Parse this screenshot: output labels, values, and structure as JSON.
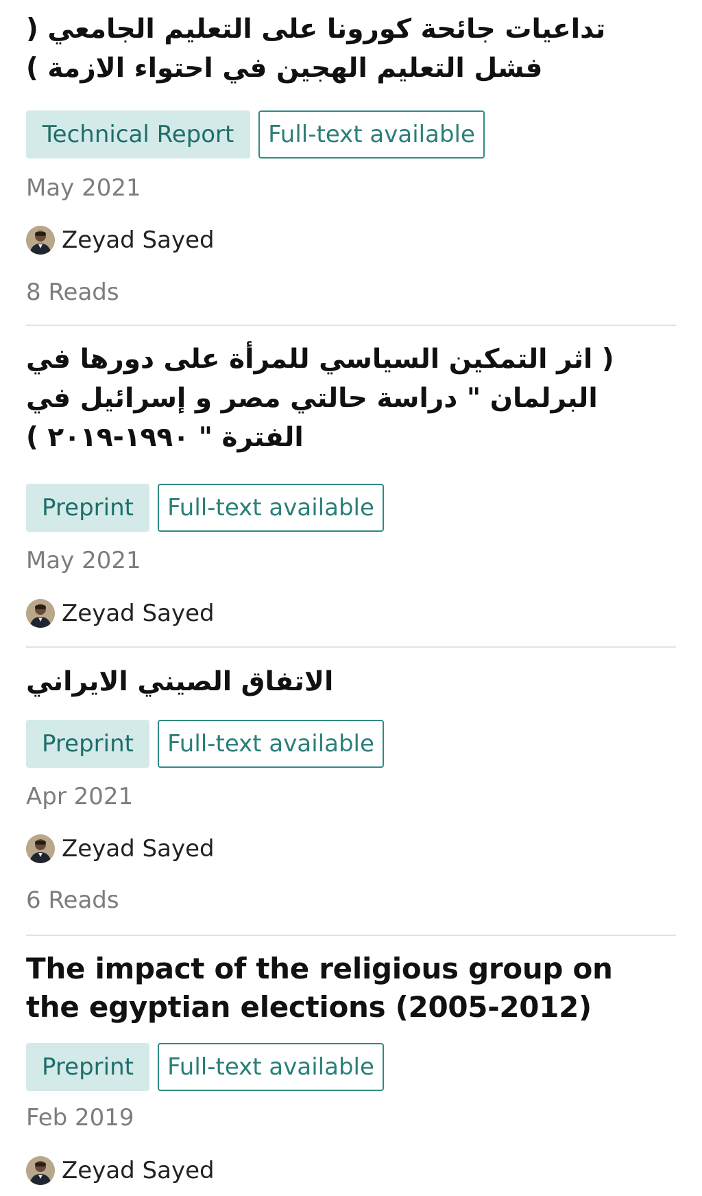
{
  "publications": [
    {
      "title": "تداعيات جائحة كورونا على التعليم الجامعي ( فشل التعليم الهجين في احتواء الازمة )",
      "type": "Technical Report",
      "availability": "Full-text available",
      "date": "May 2021",
      "author": "Zeyad Sayed",
      "reads": "8 Reads"
    },
    {
      "title": "( اثر التمكين السياسي للمرأة على دورها في البرلمان \" دراسة حالتي مصر و إسرائيل في الفترة \" ١٩٩٠-٢٠١٩ )",
      "type": "Preprint",
      "availability": "Full-text available",
      "date": "May 2021",
      "author": "Zeyad Sayed"
    },
    {
      "title": "الاتفاق الصيني الايراني",
      "type": "Preprint",
      "availability": "Full-text available",
      "date": "Apr 2021",
      "author": "Zeyad Sayed",
      "reads": "6 Reads"
    },
    {
      "title": "The impact of the religious group on the egyptian elections (2005-2012)",
      "type": "Preprint",
      "availability": "Full-text available",
      "date": "Feb 2019",
      "author": "Zeyad Sayed"
    }
  ]
}
